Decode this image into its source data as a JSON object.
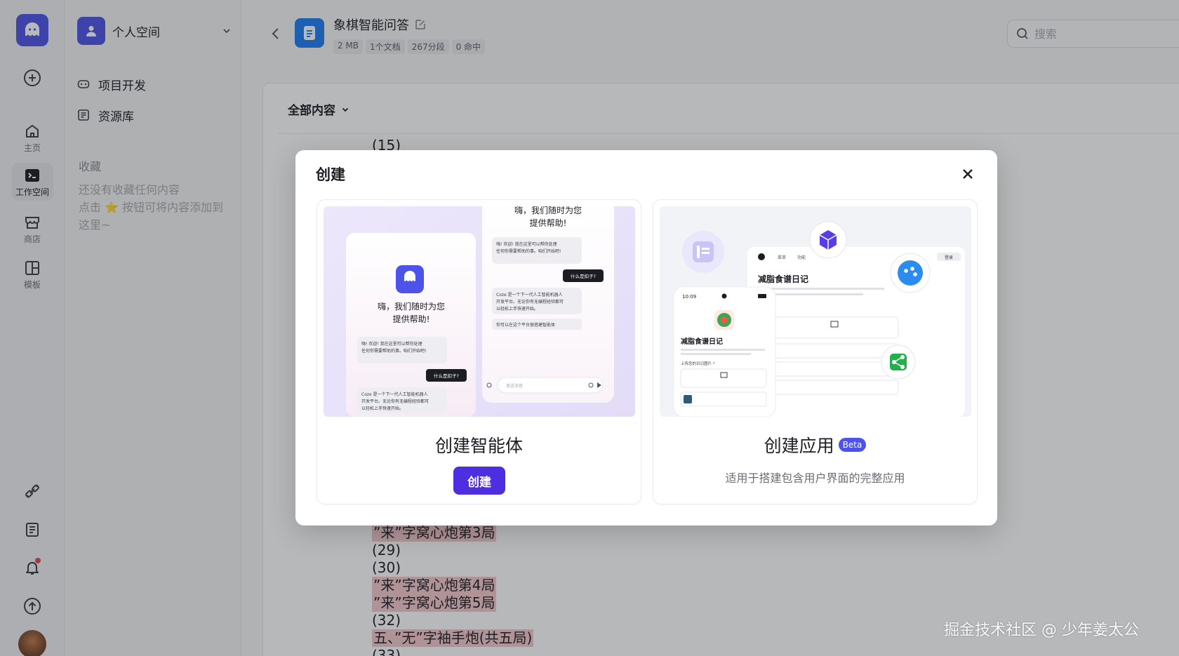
{
  "rail": {
    "items": [
      {
        "label": "主页"
      },
      {
        "label": "工作空间"
      },
      {
        "label": "商店"
      },
      {
        "label": "模板"
      }
    ]
  },
  "sidebar": {
    "space_name": "个人空间",
    "nav": [
      {
        "label": "项目开发"
      },
      {
        "label": "资源库"
      }
    ],
    "favorites_title": "收藏",
    "favorites_empty_line1": "还没有收藏任何内容",
    "favorites_empty_line2": "点击 ⭐ 按钮可将内容添加到",
    "favorites_empty_line3": "这里~"
  },
  "header": {
    "title": "象棋智能问答",
    "meta": [
      "2 MB",
      "1个文档",
      "267分段",
      "0 命中"
    ],
    "search_placeholder": "搜索"
  },
  "content": {
    "filter_label": "全部内容",
    "segments_top": [
      {
        "text": "(15)",
        "highlight": false
      }
    ],
    "segments_bottom": [
      {
        "text": "”来”字窝心炮第3局",
        "highlight": true
      },
      {
        "text": "(29)",
        "highlight": false
      },
      {
        "text": "(30)",
        "highlight": false
      },
      {
        "text": "”来”字窝心炮第4局",
        "highlight": true
      },
      {
        "text": "”来”字窝心炮第5局",
        "highlight": true
      },
      {
        "text": "(32)",
        "highlight": false
      },
      {
        "text": "五、”无”字袖手炮(共五局)",
        "highlight": true
      },
      {
        "text": "(33)",
        "highlight": false
      }
    ]
  },
  "modal": {
    "title": "创建",
    "agent_card": {
      "label": "创建智能体",
      "button": "创建",
      "preview": {
        "greeting": "嗨，我们随时为您提供帮助!",
        "greeting_top1": "嗨，我们随时为您",
        "greeting_top2": "提供帮助!",
        "bubble1": "嗨! 欢迎! 我在这里可以帮你处理任何你需要帮助的事。咱们开始吧!",
        "question": "什么是扣子?",
        "answer": "Coze 是一个下一代人工智能机器人开发平台。无论你有无编程经验都可以轻松上手快速开始。",
        "hint": "你可以在这个平台很搭建智能体",
        "input_placeholder": "发送消息"
      }
    },
    "app_card": {
      "label": "创建应用",
      "badge": "Beta",
      "description": "适用于搭建包含用户界面的完整应用",
      "preview": {
        "app_title": "减脂食谱日记",
        "time": "10:09",
        "upload_label": "上传您的日记图片 *",
        "tab1": "菜单",
        "tab2": "功能",
        "login": "登录"
      }
    }
  },
  "watermark": "掘金技术社区 @ 少年姜太公"
}
